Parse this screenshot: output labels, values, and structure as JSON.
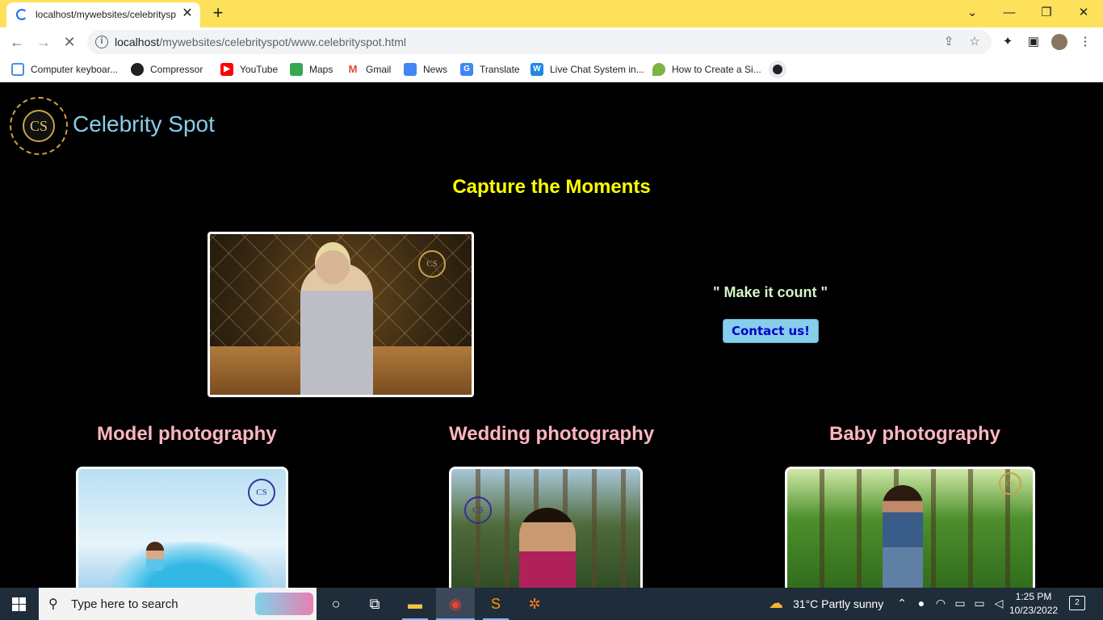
{
  "browser": {
    "tab_title": "localhost/mywebsites/celebritysp",
    "url_host": "localhost",
    "url_path": "/mywebsites/celebrityspot/www.celebrityspot.html",
    "theme_color": "#fde15a"
  },
  "bookmarks": [
    {
      "label": "Computer keyboar...",
      "icon": "globe-icon"
    },
    {
      "label": "Compressor",
      "icon": "compressor-icon"
    },
    {
      "label": "YouTube",
      "icon": "youtube-icon"
    },
    {
      "label": "Maps",
      "icon": "maps-icon"
    },
    {
      "label": "Gmail",
      "icon": "gmail-icon"
    },
    {
      "label": "News",
      "icon": "news-icon"
    },
    {
      "label": "Translate",
      "icon": "translate-icon"
    },
    {
      "label": "Live Chat System in...",
      "icon": "w3-icon"
    },
    {
      "label": "How to Create a Si...",
      "icon": "leaf-icon"
    }
  ],
  "site": {
    "logo_text": "CS",
    "title": "Celebrity Spot",
    "hero_heading": "Capture the Moments",
    "tagline": "\" Make it count \"",
    "contact_label": "Contact us!",
    "watermark": "CS",
    "categories": [
      {
        "title": "Model photography"
      },
      {
        "title": "Wedding photography"
      },
      {
        "title": "Baby photography"
      }
    ]
  },
  "taskbar": {
    "search_placeholder": "Type here to search",
    "weather": "31°C  Partly sunny",
    "time": "1:25 PM",
    "date": "10/23/2022",
    "notifications": "2"
  }
}
